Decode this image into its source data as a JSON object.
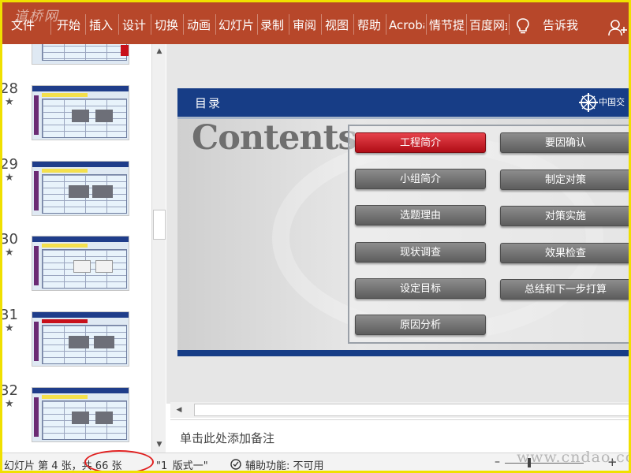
{
  "ribbon": {
    "tabs": [
      "文件",
      "开始",
      "插入",
      "设计",
      "切换",
      "动画",
      "幻灯片",
      "录制",
      "审阅",
      "视图",
      "帮助",
      "Acrobat",
      "情节提要",
      "百度网盘"
    ],
    "tell_me": "告诉我",
    "watermark": "道桥网",
    "color": "#b7472a"
  },
  "thumbnails": {
    "items": [
      {
        "number": "28"
      },
      {
        "number": "29"
      },
      {
        "number": "30"
      },
      {
        "number": "31"
      },
      {
        "number": "32"
      }
    ]
  },
  "slide": {
    "header_title": "目录",
    "logo_text": "中国交",
    "contents_title": "Contents",
    "menu_left": [
      "工程简介",
      "小组简介",
      "选题理由",
      "现状调查",
      "设定目标",
      "原因分析"
    ],
    "menu_right": [
      "要因确认",
      "制定对策",
      "对策实施",
      "效果检查",
      "总结和下一步打算"
    ],
    "active_item": "工程简介",
    "colors": {
      "header": "#173d86",
      "active_button": "#c8101a",
      "button": "#6d6d6d"
    }
  },
  "notes": {
    "placeholder": "单击此处添加备注"
  },
  "status": {
    "slide_info": "幻灯片 第 4 张，共 66 张",
    "layout": "\"1_版式一\"",
    "accessibility": "辅助功能: 不可用",
    "watermark": "www.cndao.com"
  }
}
